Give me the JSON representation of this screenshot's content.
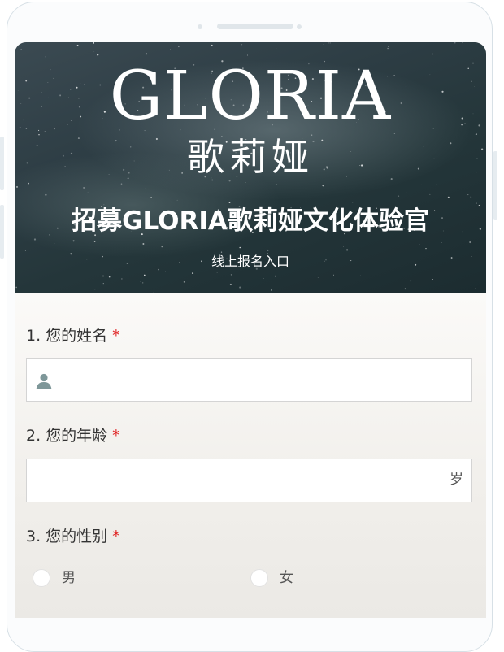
{
  "banner": {
    "brand_en": "GLORIA",
    "brand_cn": "歌莉娅",
    "title": "招募GLORIA歌莉娅文化体验官",
    "subtitle": "线上报名入口"
  },
  "form": {
    "required_mark": "*",
    "questions": [
      {
        "label": "1. 您的姓名",
        "placeholder": "",
        "icon": "person-icon"
      },
      {
        "label": "2. 您的年龄",
        "placeholder": "",
        "suffix": "岁"
      },
      {
        "label": "3. 您的性别",
        "options": [
          "男",
          "女"
        ]
      }
    ]
  },
  "colors": {
    "required": "#e02020",
    "banner_dark": "#24363a",
    "frame": "#d7e0e6"
  }
}
